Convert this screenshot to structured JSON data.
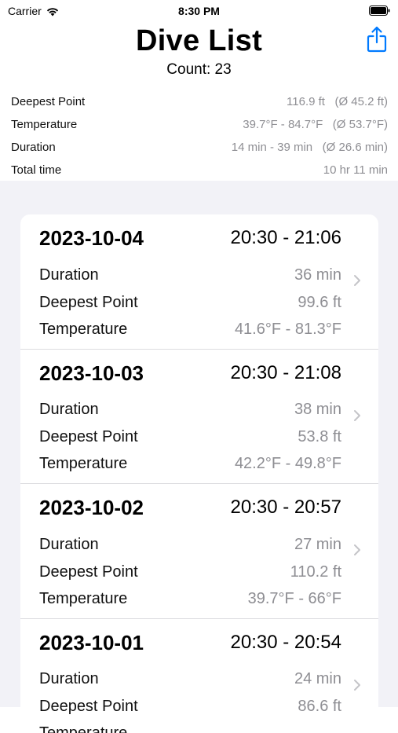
{
  "status_bar": {
    "carrier": "Carrier",
    "time": "8:30 PM"
  },
  "header": {
    "title": "Dive List",
    "count": "Count: 23",
    "share_icon": "share-icon"
  },
  "summary": [
    {
      "label": "Deepest Point",
      "value": "116.9 ft   (Ø 45.2 ft)"
    },
    {
      "label": "Temperature",
      "value": "39.7°F - 84.7°F   (Ø 53.7°F)"
    },
    {
      "label": "Duration",
      "value": "14 min - 39 min   (Ø 26.6 min)"
    },
    {
      "label": "Total time",
      "value": "10 hr 11 min"
    }
  ],
  "dives": [
    {
      "date": "2023-10-04",
      "time_range": "20:30 - 21:06",
      "duration_label": "Duration",
      "duration": "36 min",
      "depth_label": "Deepest Point",
      "depth": "99.6 ft",
      "temp_label": "Temperature",
      "temp": "41.6°F - 81.3°F"
    },
    {
      "date": "2023-10-03",
      "time_range": "20:30 - 21:08",
      "duration_label": "Duration",
      "duration": "38 min",
      "depth_label": "Deepest Point",
      "depth": "53.8 ft",
      "temp_label": "Temperature",
      "temp": "42.2°F - 49.8°F"
    },
    {
      "date": "2023-10-02",
      "time_range": "20:30 - 20:57",
      "duration_label": "Duration",
      "duration": "27 min",
      "depth_label": "Deepest Point",
      "depth": "110.2 ft",
      "temp_label": "Temperature",
      "temp": "39.7°F - 66°F"
    },
    {
      "date": "2023-10-01",
      "time_range": "20:30 - 20:54",
      "duration_label": "Duration",
      "duration": "24 min",
      "depth_label": "Deepest Point",
      "depth": "86.6 ft",
      "temp_label": "Temperature",
      "temp": ""
    }
  ],
  "colors": {
    "accent": "#007aff",
    "secondary_text": "#8e8e93",
    "grouped_background": "#f2f2f7"
  }
}
